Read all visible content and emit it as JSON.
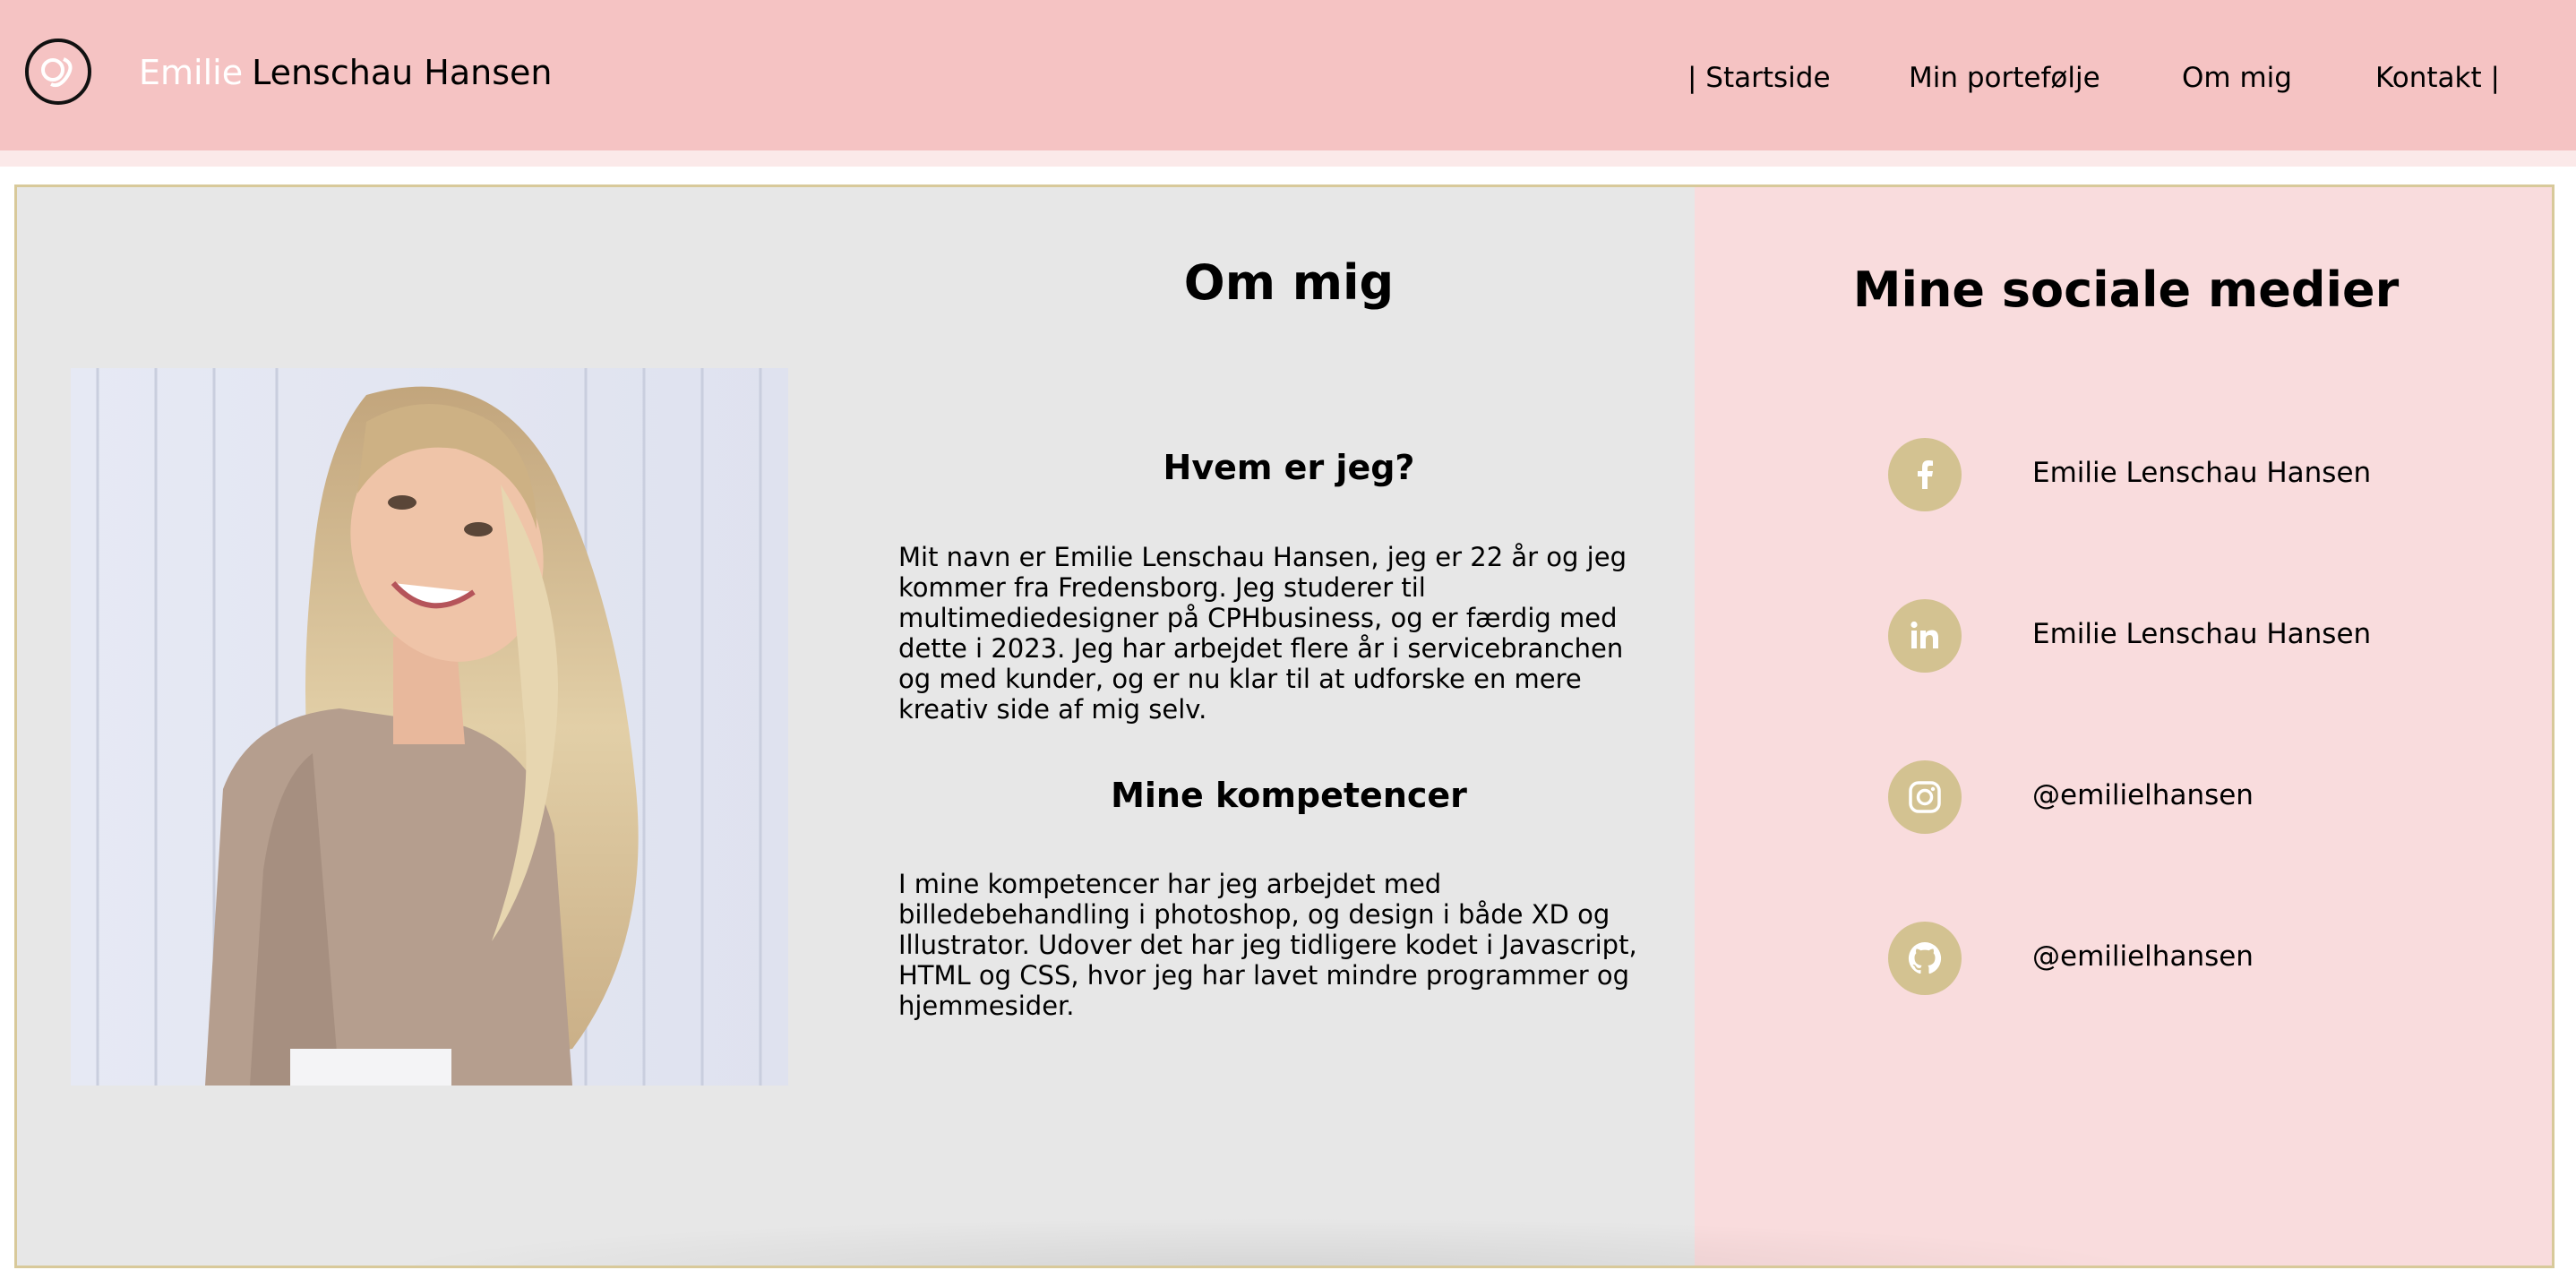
{
  "header": {
    "first_name": "Emilie",
    "last_name": "Lenschau Hansen",
    "nav": [
      "| Startside",
      "Min portefølje",
      "Om mig",
      "Kontakt |"
    ]
  },
  "about": {
    "title": "Om mig",
    "who_heading": "Hvem er jeg?",
    "who_text": "Mit navn er Emilie Lenschau Hansen, jeg er 22 år og jeg kommer fra Fredensborg. Jeg studerer til multimediedesigner på CPHbusiness, og er færdig med dette i 2023. Jeg har arbejdet flere år i servicebranchen og med kunder, og er nu klar til at udforske en mere kreativ side af mig selv.",
    "skills_heading": "Mine kompetencer",
    "skills_text": "I mine kompetencer har jeg arbejdet med billedebehandling i photoshop, og design i både XD og Illustrator. Udover det har jeg tidligere kodet i Javascript, HTML og CSS, hvor jeg har lavet mindre programmer og hjemmesider."
  },
  "social": {
    "title": "Mine sociale medier",
    "items": [
      {
        "icon": "facebook-icon",
        "label": "Emilie Lenschau Hansen"
      },
      {
        "icon": "linkedin-icon",
        "label": "Emilie Lenschau Hansen"
      },
      {
        "icon": "instagram-icon",
        "label": "@emilielhansen"
      },
      {
        "icon": "github-icon",
        "label": "@emilielhansen"
      }
    ]
  },
  "colors": {
    "header_bg": "#f5c3c3",
    "panel_pink": "#f9dcdd",
    "panel_gray": "#e7e7e7",
    "accent_gold": "#d3c291"
  }
}
